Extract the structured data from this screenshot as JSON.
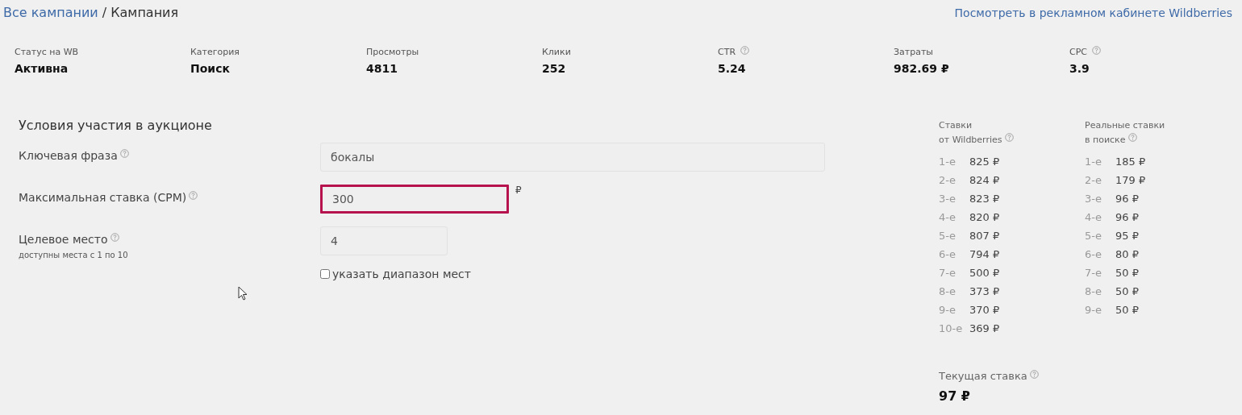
{
  "breadcrumb": {
    "link": "Все кампании",
    "separator": "/",
    "current": "Кампания"
  },
  "external_link": "Посмотреть в рекламном кабинете Wildberries",
  "stats": [
    {
      "label": "Статус на WB",
      "value": "Активна",
      "help": false
    },
    {
      "label": "Категория",
      "value": "Поиск",
      "help": false
    },
    {
      "label": "Просмотры",
      "value": "4811",
      "help": false
    },
    {
      "label": "Клики",
      "value": "252",
      "help": false
    },
    {
      "label": "CTR",
      "value": "5.24",
      "help": true
    },
    {
      "label": "Затраты",
      "value": "982.69 ₽",
      "help": false
    },
    {
      "label": "CPC",
      "value": "3.9",
      "help": true
    }
  ],
  "auction": {
    "title": "Условия участия в аукционе",
    "fields": [
      {
        "label": "Ключевая фраза",
        "help": true,
        "value": "бокалы",
        "error": false
      },
      {
        "label": "Максимальная ставка (CPM)",
        "help": true,
        "value": "300",
        "error": true,
        "unit": "₽"
      },
      {
        "label": "Целевое место",
        "help": true,
        "value": "4",
        "error": false,
        "hint": "доступны места с 1 по 10"
      }
    ],
    "range_checkbox": {
      "label": "указать диапазон мест",
      "checked": false
    }
  },
  "bid_tables": [
    {
      "title_lines": [
        "Ставки",
        "от Wildberries"
      ],
      "help": true,
      "rows": [
        {
          "place": "1-е",
          "price": "825 ₽"
        },
        {
          "place": "2-е",
          "price": "824 ₽"
        },
        {
          "place": "3-е",
          "price": "823 ₽"
        },
        {
          "place": "4-е",
          "price": "820 ₽"
        },
        {
          "place": "5-е",
          "price": "807 ₽"
        },
        {
          "place": "6-е",
          "price": "794 ₽"
        },
        {
          "place": "7-е",
          "price": "500 ₽"
        },
        {
          "place": "8-е",
          "price": "373 ₽"
        },
        {
          "place": "9-е",
          "price": "370 ₽"
        },
        {
          "place": "10-е",
          "price": "369 ₽"
        }
      ]
    },
    {
      "title_lines": [
        "Реальные ставки",
        "в поиске"
      ],
      "help": true,
      "rows": [
        {
          "place": "1-е",
          "price": "185 ₽"
        },
        {
          "place": "2-е",
          "price": "179 ₽"
        },
        {
          "place": "3-е",
          "price": "96 ₽"
        },
        {
          "place": "4-е",
          "price": "96 ₽"
        },
        {
          "place": "5-е",
          "price": "95 ₽"
        },
        {
          "place": "6-е",
          "price": "80 ₽"
        },
        {
          "place": "7-е",
          "price": "50 ₽"
        },
        {
          "place": "8-е",
          "price": "50 ₽"
        },
        {
          "place": "9-е",
          "price": "50 ₽"
        }
      ]
    }
  ],
  "current_bid": {
    "label": "Текущая ставка",
    "help": true,
    "value": "97 ₽"
  }
}
